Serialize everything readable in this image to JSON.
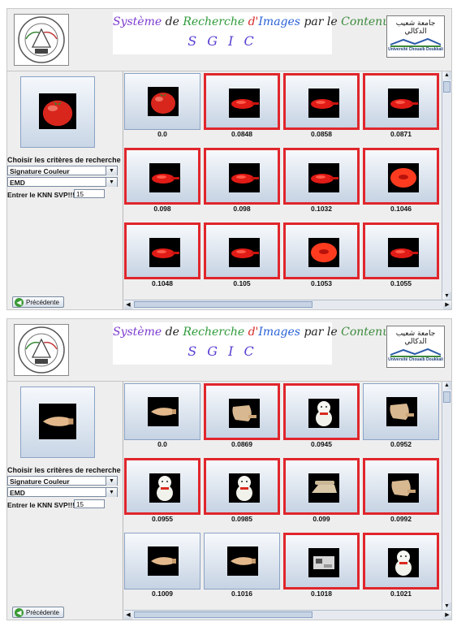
{
  "header": {
    "title_parts": [
      {
        "text": "Système ",
        "color": "#7d3ccf"
      },
      {
        "text": "de ",
        "color": "#222222"
      },
      {
        "text": "Recherche ",
        "color": "#2f9a3a"
      },
      {
        "text": "d'",
        "color": "#d62b2b"
      },
      {
        "text": "Images ",
        "color": "#2a62d6"
      },
      {
        "text": "par le ",
        "color": "#222222"
      },
      {
        "text": "Contenu",
        "color": "#3c8a3c"
      }
    ],
    "subtitle": "S G I C",
    "right_logo_text": "جامعة شعيب الدكالي",
    "right_logo_sub": "Université Chouaib Doukkali"
  },
  "controls": {
    "criteria_label": "Choisir les critères de recherche",
    "signature_value": "Signature Couleur",
    "distance_value": "EMD",
    "knn_label": "Entrer le KNN SVP!!!",
    "knn_value": "15",
    "prev_label": "Précédente"
  },
  "panels": [
    {
      "query_kind": "tomato",
      "results": [
        {
          "score": "0.0",
          "kind": "tomato",
          "hit": false
        },
        {
          "score": "0.0848",
          "kind": "dish",
          "hit": true
        },
        {
          "score": "0.0858",
          "kind": "dish",
          "hit": true
        },
        {
          "score": "0.0871",
          "kind": "dish",
          "hit": true
        },
        {
          "score": "0.098",
          "kind": "dish",
          "hit": true
        },
        {
          "score": "0.098",
          "kind": "dish",
          "hit": true
        },
        {
          "score": "0.1032",
          "kind": "dish",
          "hit": true
        },
        {
          "score": "0.1046",
          "kind": "ring",
          "hit": true
        },
        {
          "score": "0.1048",
          "kind": "dish",
          "hit": true
        },
        {
          "score": "0.105",
          "kind": "dish",
          "hit": true
        },
        {
          "score": "0.1053",
          "kind": "ring",
          "hit": true
        },
        {
          "score": "0.1055",
          "kind": "dish",
          "hit": true
        }
      ]
    },
    {
      "query_kind": "reamer",
      "results": [
        {
          "score": "0.0",
          "kind": "reamer",
          "hit": false
        },
        {
          "score": "0.0869",
          "kind": "scoop",
          "hit": true
        },
        {
          "score": "0.0945",
          "kind": "cat",
          "hit": true
        },
        {
          "score": "0.0952",
          "kind": "scoop",
          "hit": false
        },
        {
          "score": "0.0955",
          "kind": "cat",
          "hit": true
        },
        {
          "score": "0.0985",
          "kind": "cat",
          "hit": true
        },
        {
          "score": "0.099",
          "kind": "phone",
          "hit": true
        },
        {
          "score": "0.0992",
          "kind": "scoop",
          "hit": true
        },
        {
          "score": "0.1009",
          "kind": "reamer",
          "hit": false
        },
        {
          "score": "0.1016",
          "kind": "reamer",
          "hit": false
        },
        {
          "score": "0.1018",
          "kind": "machine",
          "hit": true
        },
        {
          "score": "0.1021",
          "kind": "cat",
          "hit": true
        }
      ]
    }
  ],
  "colors": {
    "hit_border": "#e0262c",
    "frame": "#8aa3c5"
  }
}
